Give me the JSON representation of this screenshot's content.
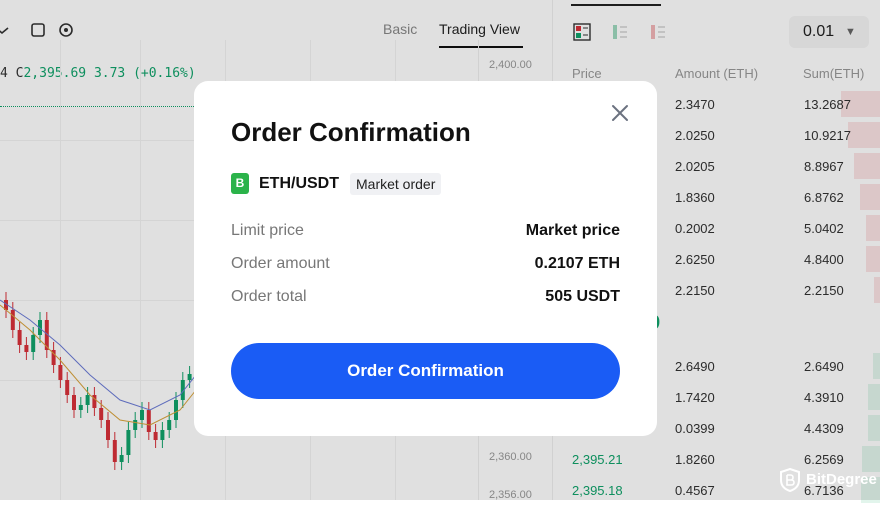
{
  "chart": {
    "tabs": [
      {
        "label": "Basic",
        "active": false
      },
      {
        "label": "Trading View",
        "active": true
      }
    ],
    "ohlc_prefix": "4 C",
    "ohlc_close": "2,395.69",
    "ohlc_change": "3.73",
    "ohlc_change_pct": "(+0.16%)",
    "price_axis": [
      "2,400.00",
      "2,360.00",
      "2,356.00"
    ],
    "accent_up": "#11a36b",
    "accent_down": "#d9303a"
  },
  "orderbook": {
    "precision": "0.01",
    "headers": {
      "price": "Price",
      "amount": "Amount (ETH)",
      "sum": "Sum(ETH)"
    },
    "asks": [
      {
        "amount": "2.3470",
        "sum": "13.2687"
      },
      {
        "amount": "2.0250",
        "sum": "10.9217"
      },
      {
        "amount": "2.0205",
        "sum": "8.8967"
      },
      {
        "amount": "1.8360",
        "sum": "6.8762"
      },
      {
        "amount": "0.2002",
        "sum": "5.0402"
      },
      {
        "amount": "2.6250",
        "sum": "4.8400"
      },
      {
        "amount": "2.2150",
        "sum": "2.2150"
      }
    ],
    "mid_price_visible": "9",
    "bids": [
      {
        "price": "",
        "amount": "2.6490",
        "sum": "2.6490"
      },
      {
        "price": "",
        "amount": "1.7420",
        "sum": "4.3910"
      },
      {
        "price": "",
        "amount": "0.0399",
        "sum": "4.4309"
      },
      {
        "price": "2,395.21",
        "amount": "1.8260",
        "sum": "6.2569"
      },
      {
        "price": "2,395.18",
        "amount": "0.4567",
        "sum": "6.7136"
      }
    ]
  },
  "modal": {
    "title": "Order Confirmation",
    "coin_badge": "B",
    "pair": "ETH/USDT",
    "order_type": "Market order",
    "details": [
      {
        "label": "Limit price",
        "value": "Market price"
      },
      {
        "label": "Order amount",
        "value": "0.2107 ETH"
      },
      {
        "label": "Order total",
        "value": "505 USDT"
      }
    ],
    "confirm_label": "Order Confirmation",
    "button_color": "#1a5cf5"
  },
  "watermark": {
    "text": "BitDegree"
  }
}
